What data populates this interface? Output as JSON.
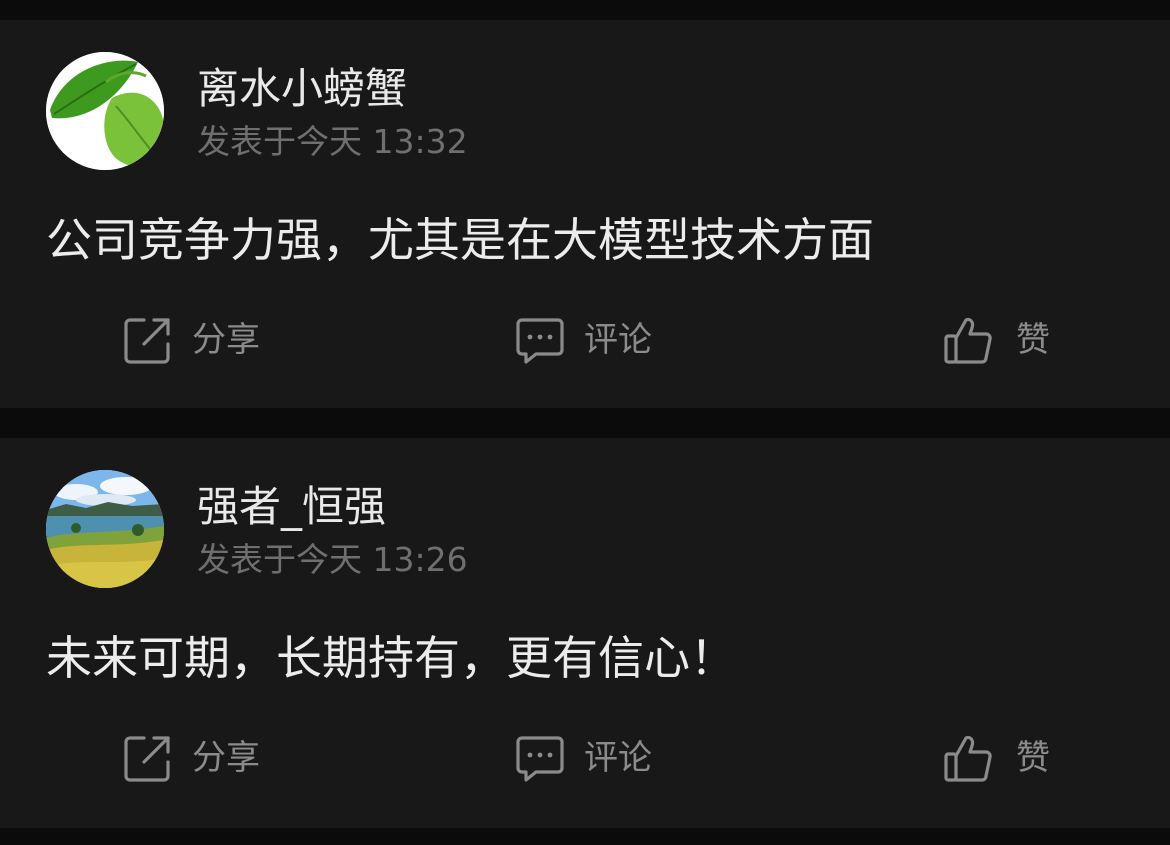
{
  "posts": [
    {
      "username": "离水小螃蟹",
      "timestamp": "发表于今天 13:32",
      "comment": "公司竞争力强，尤其是在大模型技术方面",
      "avatar_icon": "green-leaf-avatar",
      "actions": {
        "share": "分享",
        "comment": "评论",
        "like": "赞"
      }
    },
    {
      "username": "强者_恒强",
      "timestamp": "发表于今天 13:26",
      "comment": "未来可期，长期持有，更有信心！",
      "avatar_icon": "lake-landscape-avatar",
      "actions": {
        "share": "分享",
        "comment": "评论",
        "like": "赞"
      }
    }
  ],
  "colors": {
    "background": "#0b0b0b",
    "card": "#181818",
    "username": "#e9e9e9",
    "timestamp": "#6f6f6f",
    "comment": "#ececec",
    "action": "#8b8b8b"
  }
}
